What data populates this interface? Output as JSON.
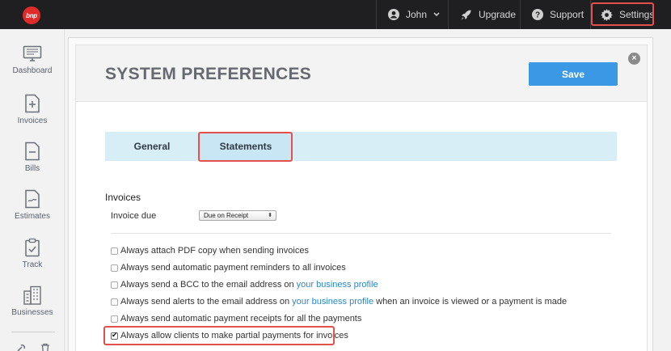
{
  "topbar": {
    "logo_text": "bnp",
    "user_name": "John",
    "upgrade_label": "Upgrade",
    "support_label": "Support",
    "settings_label": "Settings",
    "brand_color": "#e02b2b"
  },
  "sidebar": {
    "items": [
      {
        "label": "Dashboard",
        "icon": "monitor-icon"
      },
      {
        "label": "Invoices",
        "icon": "invoice-icon"
      },
      {
        "label": "Bills",
        "icon": "bill-icon"
      },
      {
        "label": "Estimates",
        "icon": "estimate-icon"
      },
      {
        "label": "Track",
        "icon": "clipboard-icon"
      },
      {
        "label": "Businesses",
        "icon": "building-icon"
      }
    ]
  },
  "panel": {
    "title": "SYSTEM PREFERENCES",
    "save_label": "Save",
    "accent_color": "#3b98e4"
  },
  "tabs": [
    {
      "label": "General",
      "active": false
    },
    {
      "label": "Statements",
      "active": true
    }
  ],
  "invoices": {
    "heading": "Invoices",
    "due_label": "Invoice due",
    "due_value": "Due on Receipt",
    "options": [
      {
        "parts": [
          "Always attach PDF copy when sending invoices"
        ],
        "checked": false
      },
      {
        "parts": [
          "Always send automatic payment reminders to all invoices"
        ],
        "checked": false
      },
      {
        "parts": [
          "Always send a BCC to the email address on ",
          "your business profile"
        ],
        "checked": false
      },
      {
        "parts": [
          "Always send alerts to the email address on ",
          "your business profile",
          " when an invoice is viewed or a payment is made"
        ],
        "checked": false
      },
      {
        "parts": [
          "Always send automatic payment receipts for all the payments"
        ],
        "checked": false
      },
      {
        "parts": [
          "Always allow clients to make partial payments for invoices"
        ],
        "checked": true
      }
    ]
  }
}
